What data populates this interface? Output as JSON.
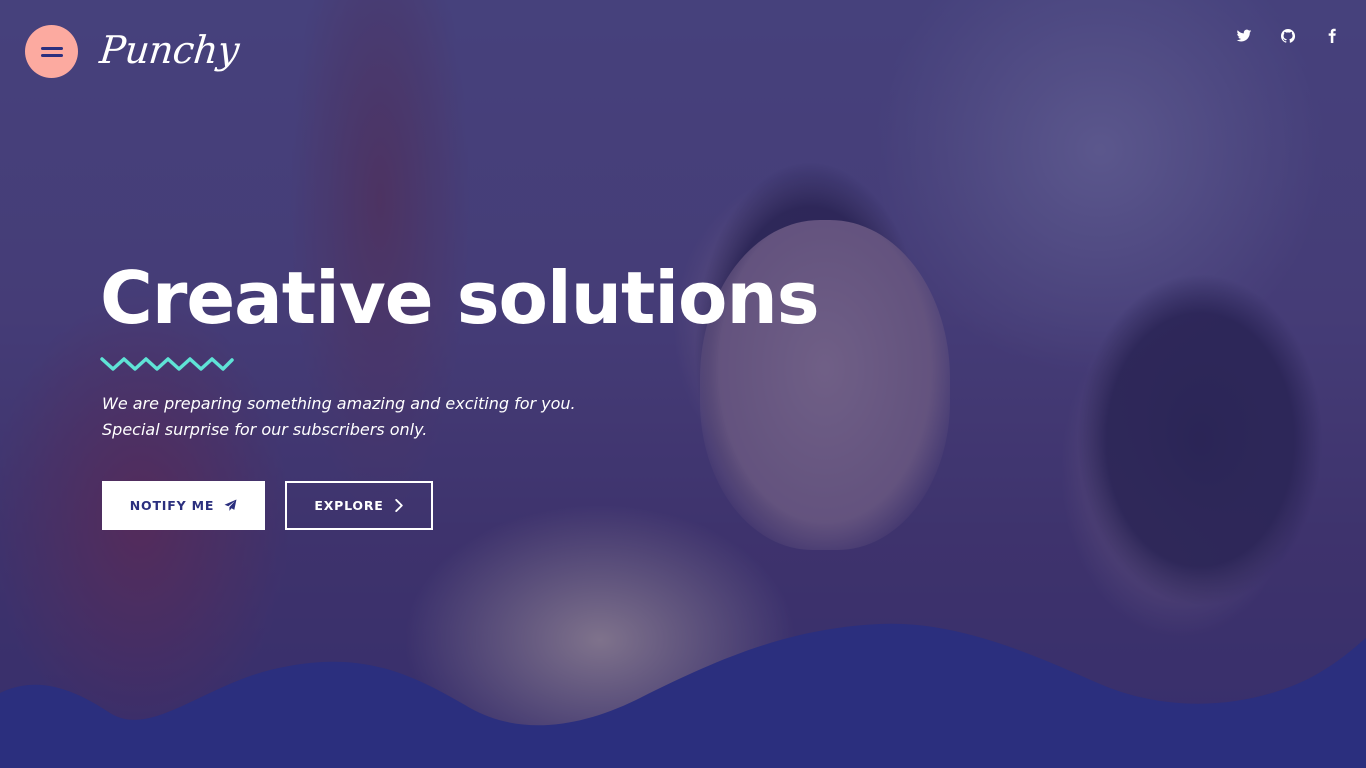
{
  "header": {
    "logo_text": "Punchy",
    "menu_icon": "hamburger-icon",
    "social": [
      {
        "name": "twitter-icon"
      },
      {
        "name": "github-icon"
      },
      {
        "name": "facebook-icon"
      }
    ]
  },
  "hero": {
    "title": "Creative solutions",
    "subtitle_line1": "We are preparing something amazing and exciting for you.",
    "subtitle_line2": "Special surprise for our subscribers only.",
    "notify_label": "NOTIFY ME",
    "notify_icon": "paper-plane-icon",
    "explore_label": "EXPLORE",
    "explore_icon": "chevron-right-icon"
  },
  "colors": {
    "accent_pink": "#fcaaa0",
    "accent_teal": "#5fe3d6",
    "wave_navy": "#2b2f7e",
    "overlay": "#342e76"
  }
}
